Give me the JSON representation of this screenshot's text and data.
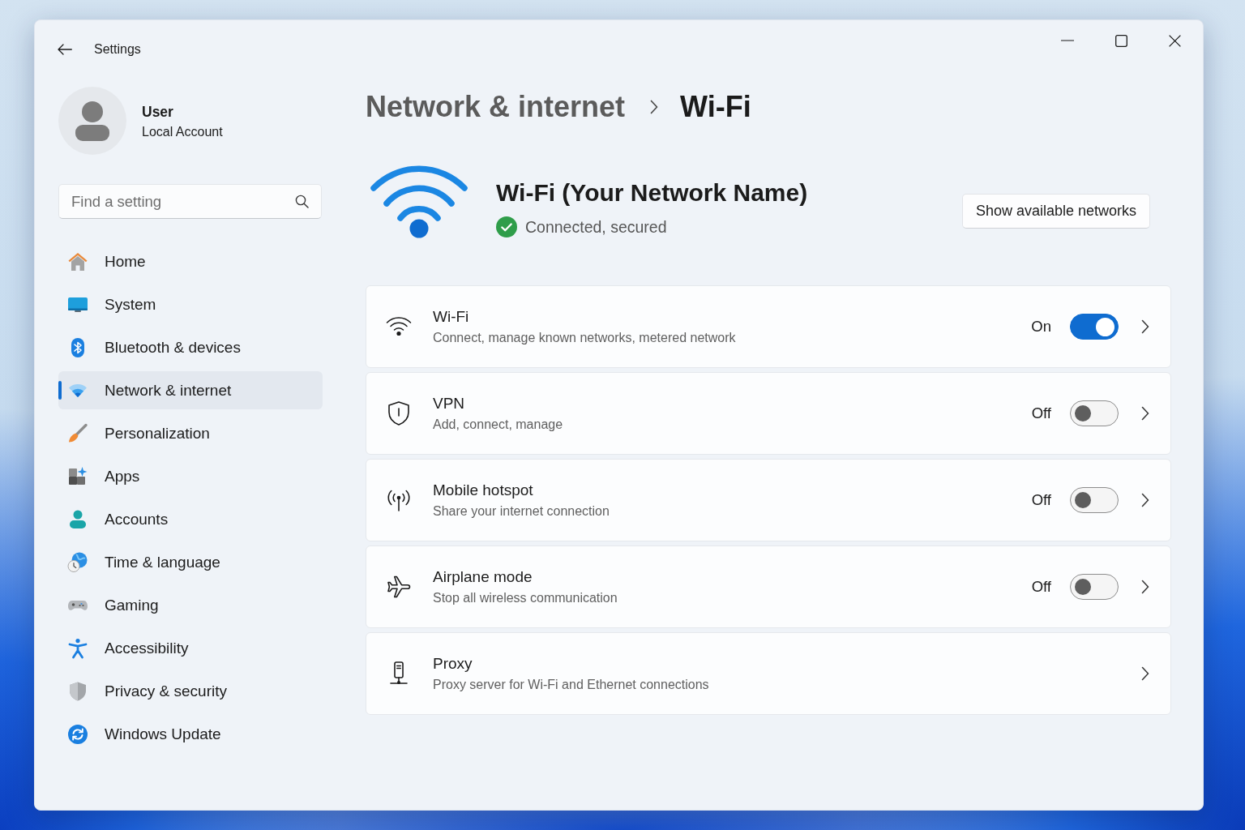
{
  "window": {
    "title": "Settings"
  },
  "user": {
    "name": "User",
    "account": "Local Account"
  },
  "search": {
    "placeholder": "Find a setting"
  },
  "sidebar": {
    "items": [
      {
        "label": "Home",
        "selected": false
      },
      {
        "label": "System",
        "selected": false
      },
      {
        "label": "Bluetooth & devices",
        "selected": false
      },
      {
        "label": "Network & internet",
        "selected": true
      },
      {
        "label": "Personalization",
        "selected": false
      },
      {
        "label": "Apps",
        "selected": false
      },
      {
        "label": "Accounts",
        "selected": false
      },
      {
        "label": "Time & language",
        "selected": false
      },
      {
        "label": "Gaming",
        "selected": false
      },
      {
        "label": "Accessibility",
        "selected": false
      },
      {
        "label": "Privacy & security",
        "selected": false
      },
      {
        "label": "Windows Update",
        "selected": false
      }
    ]
  },
  "breadcrumb": {
    "parent": "Network & internet",
    "current": "Wi-Fi"
  },
  "connection": {
    "name": "Wi-Fi (Your Network Name)",
    "status": "Connected, secured",
    "connected": true
  },
  "actions": {
    "show_networks": "Show available networks"
  },
  "settings": [
    {
      "kind": "toggle",
      "title": "Wi-Fi",
      "description": "Connect, manage known networks, metered network",
      "state_label": "On",
      "on": true
    },
    {
      "kind": "toggle",
      "title": "VPN",
      "description": "Add, connect, manage",
      "state_label": "Off",
      "on": false
    },
    {
      "kind": "toggle",
      "title": "Mobile hotspot",
      "description": "Share your internet connection",
      "state_label": "Off",
      "on": false
    },
    {
      "kind": "toggle",
      "title": "Airplane mode",
      "description": "Stop all wireless communication",
      "state_label": "Off",
      "on": false
    },
    {
      "kind": "link",
      "title": "Proxy",
      "description": "Proxy server for Wi-Fi and Ethernet connections"
    }
  ]
}
